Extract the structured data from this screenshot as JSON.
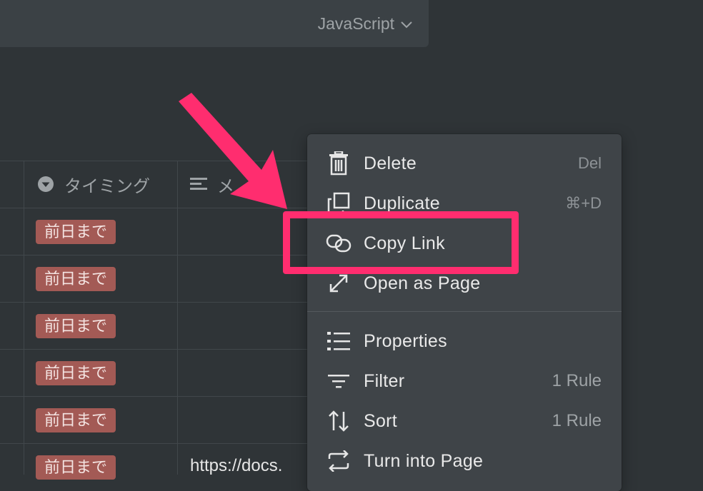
{
  "code_block": {
    "language": "JavaScript"
  },
  "table": {
    "columns": [
      {
        "name": "タイミング",
        "icon": "dropdown-circle-icon"
      },
      {
        "name": "メ",
        "icon": "text-lines-icon"
      }
    ],
    "rows": [
      {
        "tag": "前日まで",
        "text": ""
      },
      {
        "tag": "前日まで",
        "text": ""
      },
      {
        "tag": "前日まで",
        "text": ""
      },
      {
        "tag": "前日まで",
        "text": ""
      },
      {
        "tag": "前日まで",
        "text": ""
      },
      {
        "tag": "前日まで",
        "text": "https://docs."
      }
    ]
  },
  "context_menu": {
    "items": [
      {
        "label": "Delete",
        "hint": "Del",
        "icon": "trash-icon"
      },
      {
        "label": "Duplicate",
        "hint": "⌘+D",
        "icon": "duplicate-icon"
      },
      {
        "label": "Copy Link",
        "hint": "",
        "icon": "link-icon"
      },
      {
        "label": "Open as Page",
        "hint": "",
        "icon": "expand-icon"
      },
      {
        "label": "Properties",
        "hint": "",
        "icon": "list-icon"
      },
      {
        "label": "Filter",
        "hint": "1 Rule",
        "icon": "filter-icon"
      },
      {
        "label": "Sort",
        "hint": "1 Rule",
        "icon": "sort-icon"
      },
      {
        "label": "Turn into Page",
        "hint": "",
        "icon": "convert-icon"
      }
    ]
  },
  "annotation": {
    "color": "#ff2d6f",
    "highlighted_item": "Copy Link"
  }
}
